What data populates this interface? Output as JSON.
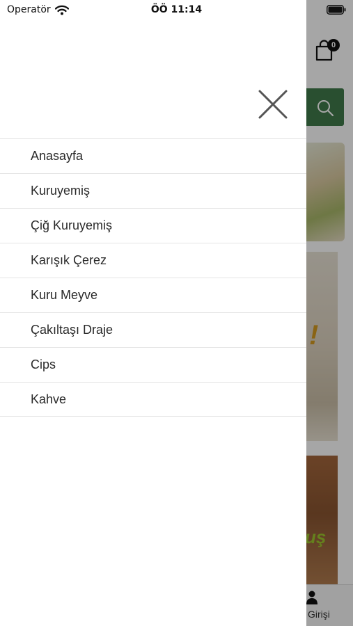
{
  "status_bar": {
    "carrier": "Operatör",
    "time": "ÖÖ 11:14",
    "wifi_icon": "wifi-icon",
    "battery_icon": "battery-icon"
  },
  "background_page": {
    "cart": {
      "icon": "shopping-bag-icon",
      "badge_count": "0"
    },
    "search_button": {
      "icon": "search-icon",
      "color": "#3f7a4a"
    },
    "banner_2_text": "!",
    "banner_3_text": "uş",
    "tab_bar": {
      "item_label": "Girişi",
      "icon": "user-icon"
    }
  },
  "drawer": {
    "close_icon": "close-icon",
    "menu_items": [
      {
        "label": "Anasayfa"
      },
      {
        "label": "Kuruyemiş"
      },
      {
        "label": "Çiğ Kuruyemiş"
      },
      {
        "label": "Karışık Çerez"
      },
      {
        "label": "Kuru Meyve"
      },
      {
        "label": "Çakıltaşı Draje"
      },
      {
        "label": "Cips"
      },
      {
        "label": "Kahve"
      }
    ]
  }
}
